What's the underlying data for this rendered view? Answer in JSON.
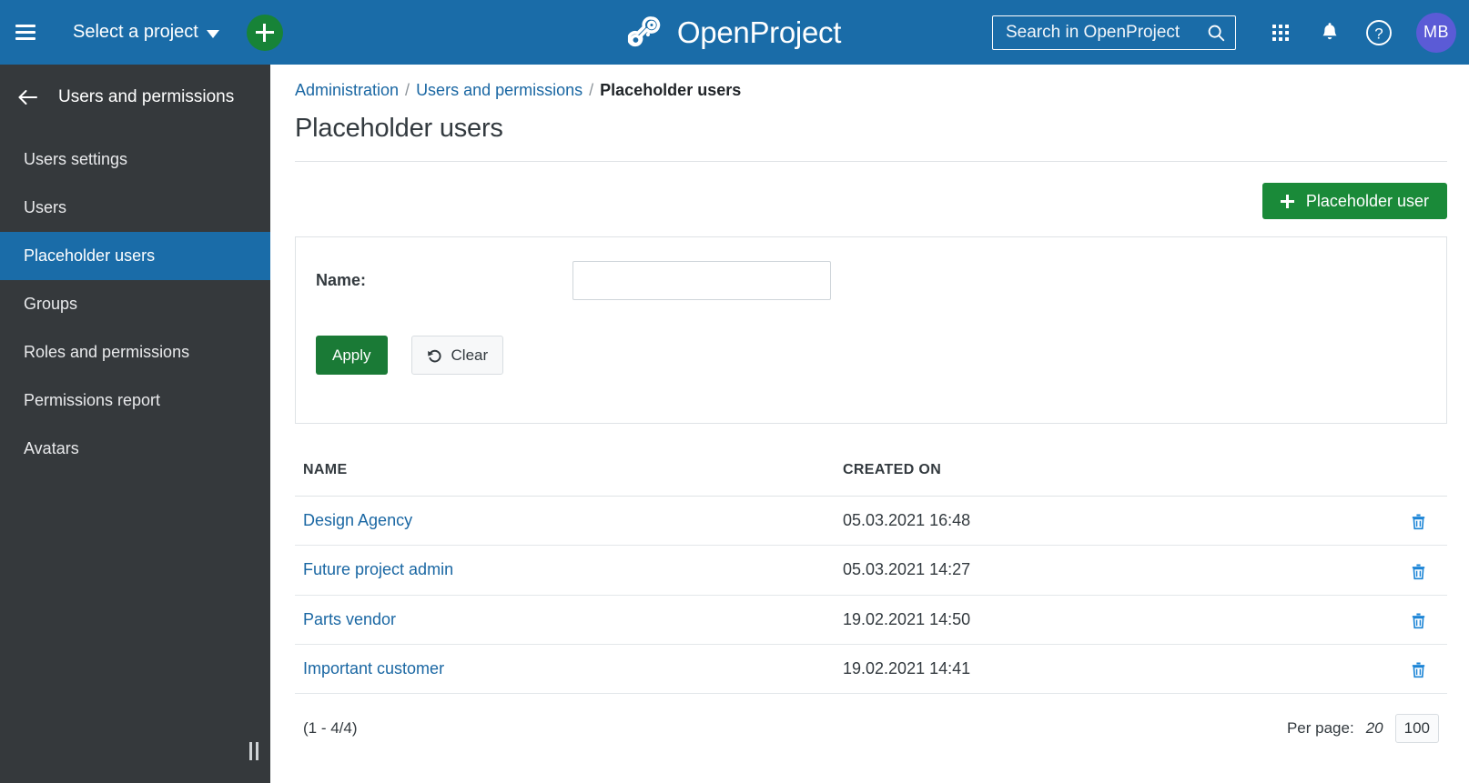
{
  "topbar": {
    "menu_icon": "hamburger-icon",
    "project_selector_label": "Select a project",
    "add_button_icon": "plus-icon",
    "brand_name": "OpenProject",
    "search_placeholder": "Search in OpenProject",
    "search_value": "",
    "modules_icon": "grid-icon",
    "notifications_icon": "bell-icon",
    "help_icon": "help-circle-icon",
    "avatar_initials": "MB",
    "accent_blue": "#1a6ca8",
    "accent_green": "#178337",
    "avatar_color": "#5b5bd6"
  },
  "sidebar": {
    "back_label": "Users and permissions",
    "items": [
      {
        "label": "Users settings",
        "active": false
      },
      {
        "label": "Users",
        "active": false
      },
      {
        "label": "Placeholder users",
        "active": true
      },
      {
        "label": "Groups",
        "active": false
      },
      {
        "label": "Roles and permissions",
        "active": false
      },
      {
        "label": "Permissions report",
        "active": false
      },
      {
        "label": "Avatars",
        "active": false
      }
    ],
    "background": "#35393c",
    "active_background": "#1a6ca8"
  },
  "breadcrumb": {
    "item1": "Administration",
    "sep1": "/",
    "item2": "Users and permissions",
    "sep2": "/",
    "current": "Placeholder users"
  },
  "page": {
    "title": "Placeholder users"
  },
  "toolbar": {
    "add_placeholder_user_label": "Placeholder user"
  },
  "filter": {
    "name_label": "Name:",
    "name_value": "",
    "name_placeholder": "",
    "apply_label": "Apply",
    "clear_label": "Clear"
  },
  "table": {
    "columns": [
      "NAME",
      "CREATED ON"
    ],
    "rows": [
      {
        "name": "Design Agency",
        "created_on": "05.03.2021 16:48",
        "delete_icon": "trash-icon"
      },
      {
        "name": "Future project admin",
        "created_on": "05.03.2021 14:27",
        "delete_icon": "trash-icon"
      },
      {
        "name": "Parts vendor",
        "created_on": "19.02.2021 14:50",
        "delete_icon": "trash-icon"
      },
      {
        "name": "Important customer",
        "created_on": "19.02.2021 14:41",
        "delete_icon": "trash-icon"
      }
    ]
  },
  "footer": {
    "range": "(1 - 4/4)",
    "per_page_label": "Per page:",
    "per_page_current": "20",
    "per_page_option": "100"
  }
}
